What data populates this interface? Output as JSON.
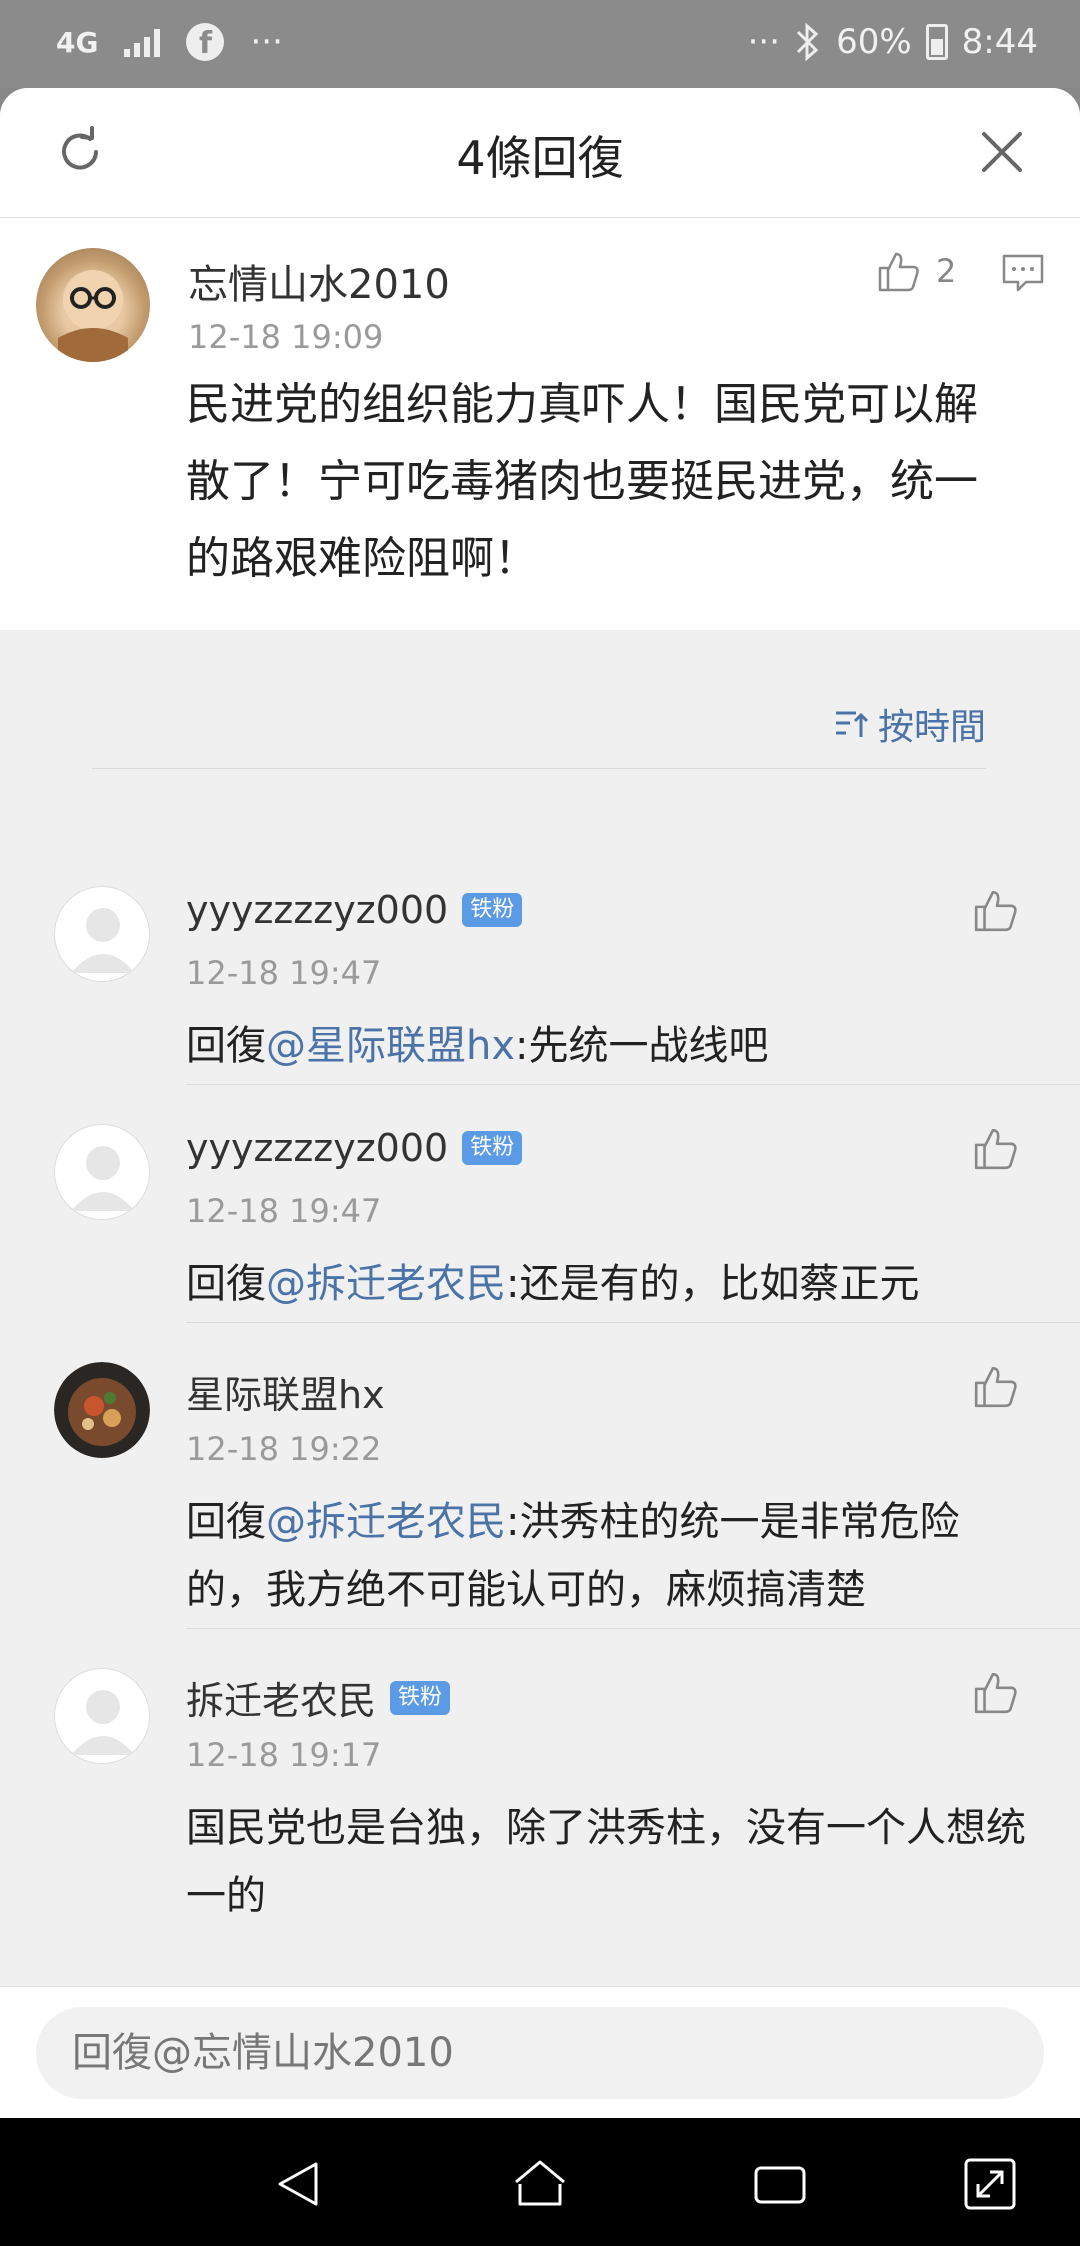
{
  "status_bar": {
    "network": "4G",
    "battery": "60%",
    "time": "8:44",
    "more": "···"
  },
  "header": {
    "title": "4條回復",
    "refresh_icon": "refresh-icon",
    "close_icon": "close-icon"
  },
  "main_comment": {
    "username": "忘情山水2010",
    "time": "12-18 19:09",
    "like_count": "2",
    "body": "民进党的组织能力真吓人！国民党可以解散了！宁可吃毒猪肉也要挺民进党，统一的路艰难险阻啊！"
  },
  "sort": {
    "label": "按時間"
  },
  "replies": [
    {
      "username": "yyyzzzzyz000",
      "badge": "铁粉",
      "time": "12-18 19:47",
      "prefix": "回復",
      "mention": "@星际联盟hx",
      "text": ":先统一战线吧"
    },
    {
      "username": "yyyzzzzyz000",
      "badge": "铁粉",
      "time": "12-18 19:47",
      "prefix": "回復",
      "mention": "@拆迁老农民",
      "text": ":还是有的，比如蔡正元"
    },
    {
      "username": "星际联盟hx",
      "badge": "",
      "time": "12-18 19:22",
      "prefix": "回復",
      "mention": "@拆迁老农民",
      "text": ":洪秀柱的统一是非常危险的，我方绝不可能认可的，麻烦搞清楚"
    },
    {
      "username": "拆迁老农民",
      "badge": "铁粉",
      "time": "12-18 19:17",
      "prefix": "",
      "mention": "",
      "text": "国民党也是台独，除了洪秀柱，没有一个人想统一的"
    }
  ],
  "input": {
    "placeholder": "回復@忘情山水2010"
  },
  "colors": {
    "accent": "#4b73a8",
    "badge": "#5b9be6",
    "background": "#f0f0f0"
  }
}
